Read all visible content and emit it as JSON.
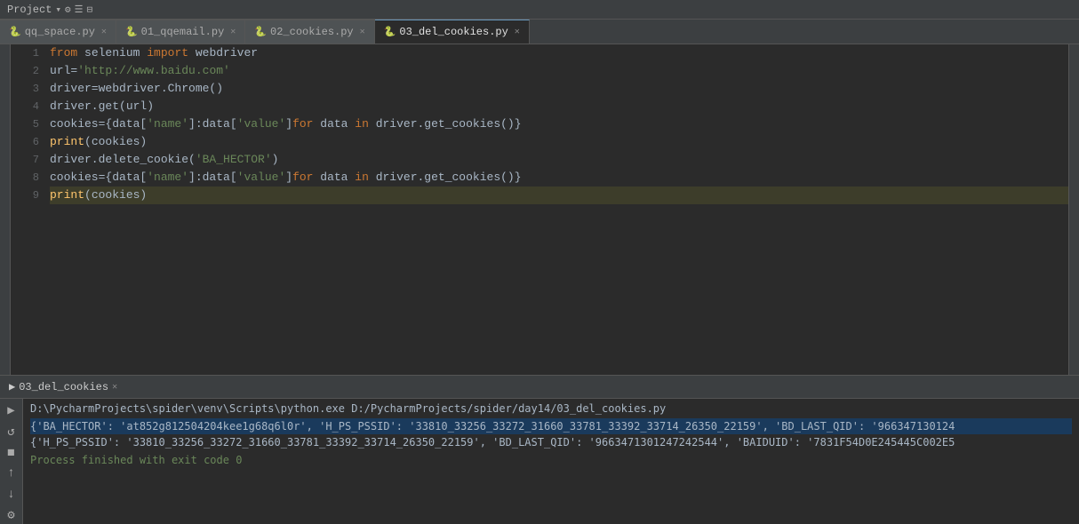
{
  "topbar": {
    "project_label": "Project",
    "icons": [
      "⚙",
      "☰",
      "⊟"
    ]
  },
  "tabs": [
    {
      "id": "qq_space",
      "label": "qq_space.py",
      "active": false
    },
    {
      "id": "qqemail",
      "label": "01_qqemail.py",
      "active": false
    },
    {
      "id": "cookies",
      "label": "02_cookies.py",
      "active": false
    },
    {
      "id": "del_cookies",
      "label": "03_del_cookies.py",
      "active": true
    }
  ],
  "code_lines": [
    {
      "num": 1,
      "tokens": [
        {
          "type": "kw",
          "text": "from"
        },
        {
          "type": "var",
          "text": " selenium "
        },
        {
          "type": "kw",
          "text": "import"
        },
        {
          "type": "var",
          "text": " webdriver"
        }
      ]
    },
    {
      "num": 2,
      "tokens": [
        {
          "type": "var",
          "text": "url="
        },
        {
          "type": "str",
          "text": "'http://www.baidu.com'"
        }
      ]
    },
    {
      "num": 3,
      "tokens": [
        {
          "type": "var",
          "text": "driver=webdriver.Chrome()"
        }
      ]
    },
    {
      "num": 4,
      "tokens": [
        {
          "type": "var",
          "text": "driver.get(url)"
        }
      ]
    },
    {
      "num": 5,
      "tokens": [
        {
          "type": "var",
          "text": "cookies={data["
        },
        {
          "type": "str",
          "text": "'name'"
        },
        {
          "type": "var",
          "text": "]:data["
        },
        {
          "type": "str",
          "text": "'value'"
        },
        {
          "type": "var",
          "text": "]}"
        },
        {
          "type": "kw",
          "text": "for"
        },
        {
          "type": "var",
          "text": " data "
        },
        {
          "type": "kw",
          "text": "in"
        },
        {
          "type": "var",
          "text": " driver.get_cookies()}}"
        }
      ]
    },
    {
      "num": 6,
      "tokens": [
        {
          "type": "fn",
          "text": "print"
        },
        {
          "type": "var",
          "text": "(cookies)"
        }
      ]
    },
    {
      "num": 7,
      "tokens": [
        {
          "type": "var",
          "text": "driver.delete_cookie("
        },
        {
          "type": "str",
          "text": "'BA_HECTOR'"
        },
        {
          "type": "var",
          "text": ")"
        }
      ]
    },
    {
      "num": 8,
      "tokens": [
        {
          "type": "var",
          "text": "cookies={data["
        },
        {
          "type": "str",
          "text": "'name'"
        },
        {
          "type": "var",
          "text": "]:data["
        },
        {
          "type": "str",
          "text": "'value'"
        },
        {
          "type": "var",
          "text": "]}"
        },
        {
          "type": "kw",
          "text": "for"
        },
        {
          "type": "var",
          "text": " data "
        },
        {
          "type": "kw",
          "text": "in"
        },
        {
          "type": "var",
          "text": " driver.get_cookies()}}"
        }
      ]
    },
    {
      "num": 9,
      "tokens": [
        {
          "type": "fn",
          "text": "print"
        },
        {
          "type": "var",
          "text": "(cookies)"
        }
      ],
      "highlighted": true
    }
  ],
  "run_panel": {
    "tab_label": "03_del_cookies",
    "command": "D:\\PycharmProjects\\spider\\venv\\Scripts\\python.exe D:/PycharmProjects/spider/day14/03_del_cookies.py",
    "output_lines": [
      "{'BA_HECTOR': 'at852g812504204kee1g68q6l0r', 'H_PS_PSSID': '33810_33256_33272_31660_33781_33392_33714_26350_22159', 'BD_LAST_QID': '966347130124",
      "{'H_PS_PSSID': '33810_33256_33272_31660_33781_33392_33714_26350_22159', 'BD_LAST_QID': '9663471301247242544', 'BAIDUID': '7831F54D0E245445C002E5"
    ],
    "finish_message": "Process finished with exit code 0"
  }
}
